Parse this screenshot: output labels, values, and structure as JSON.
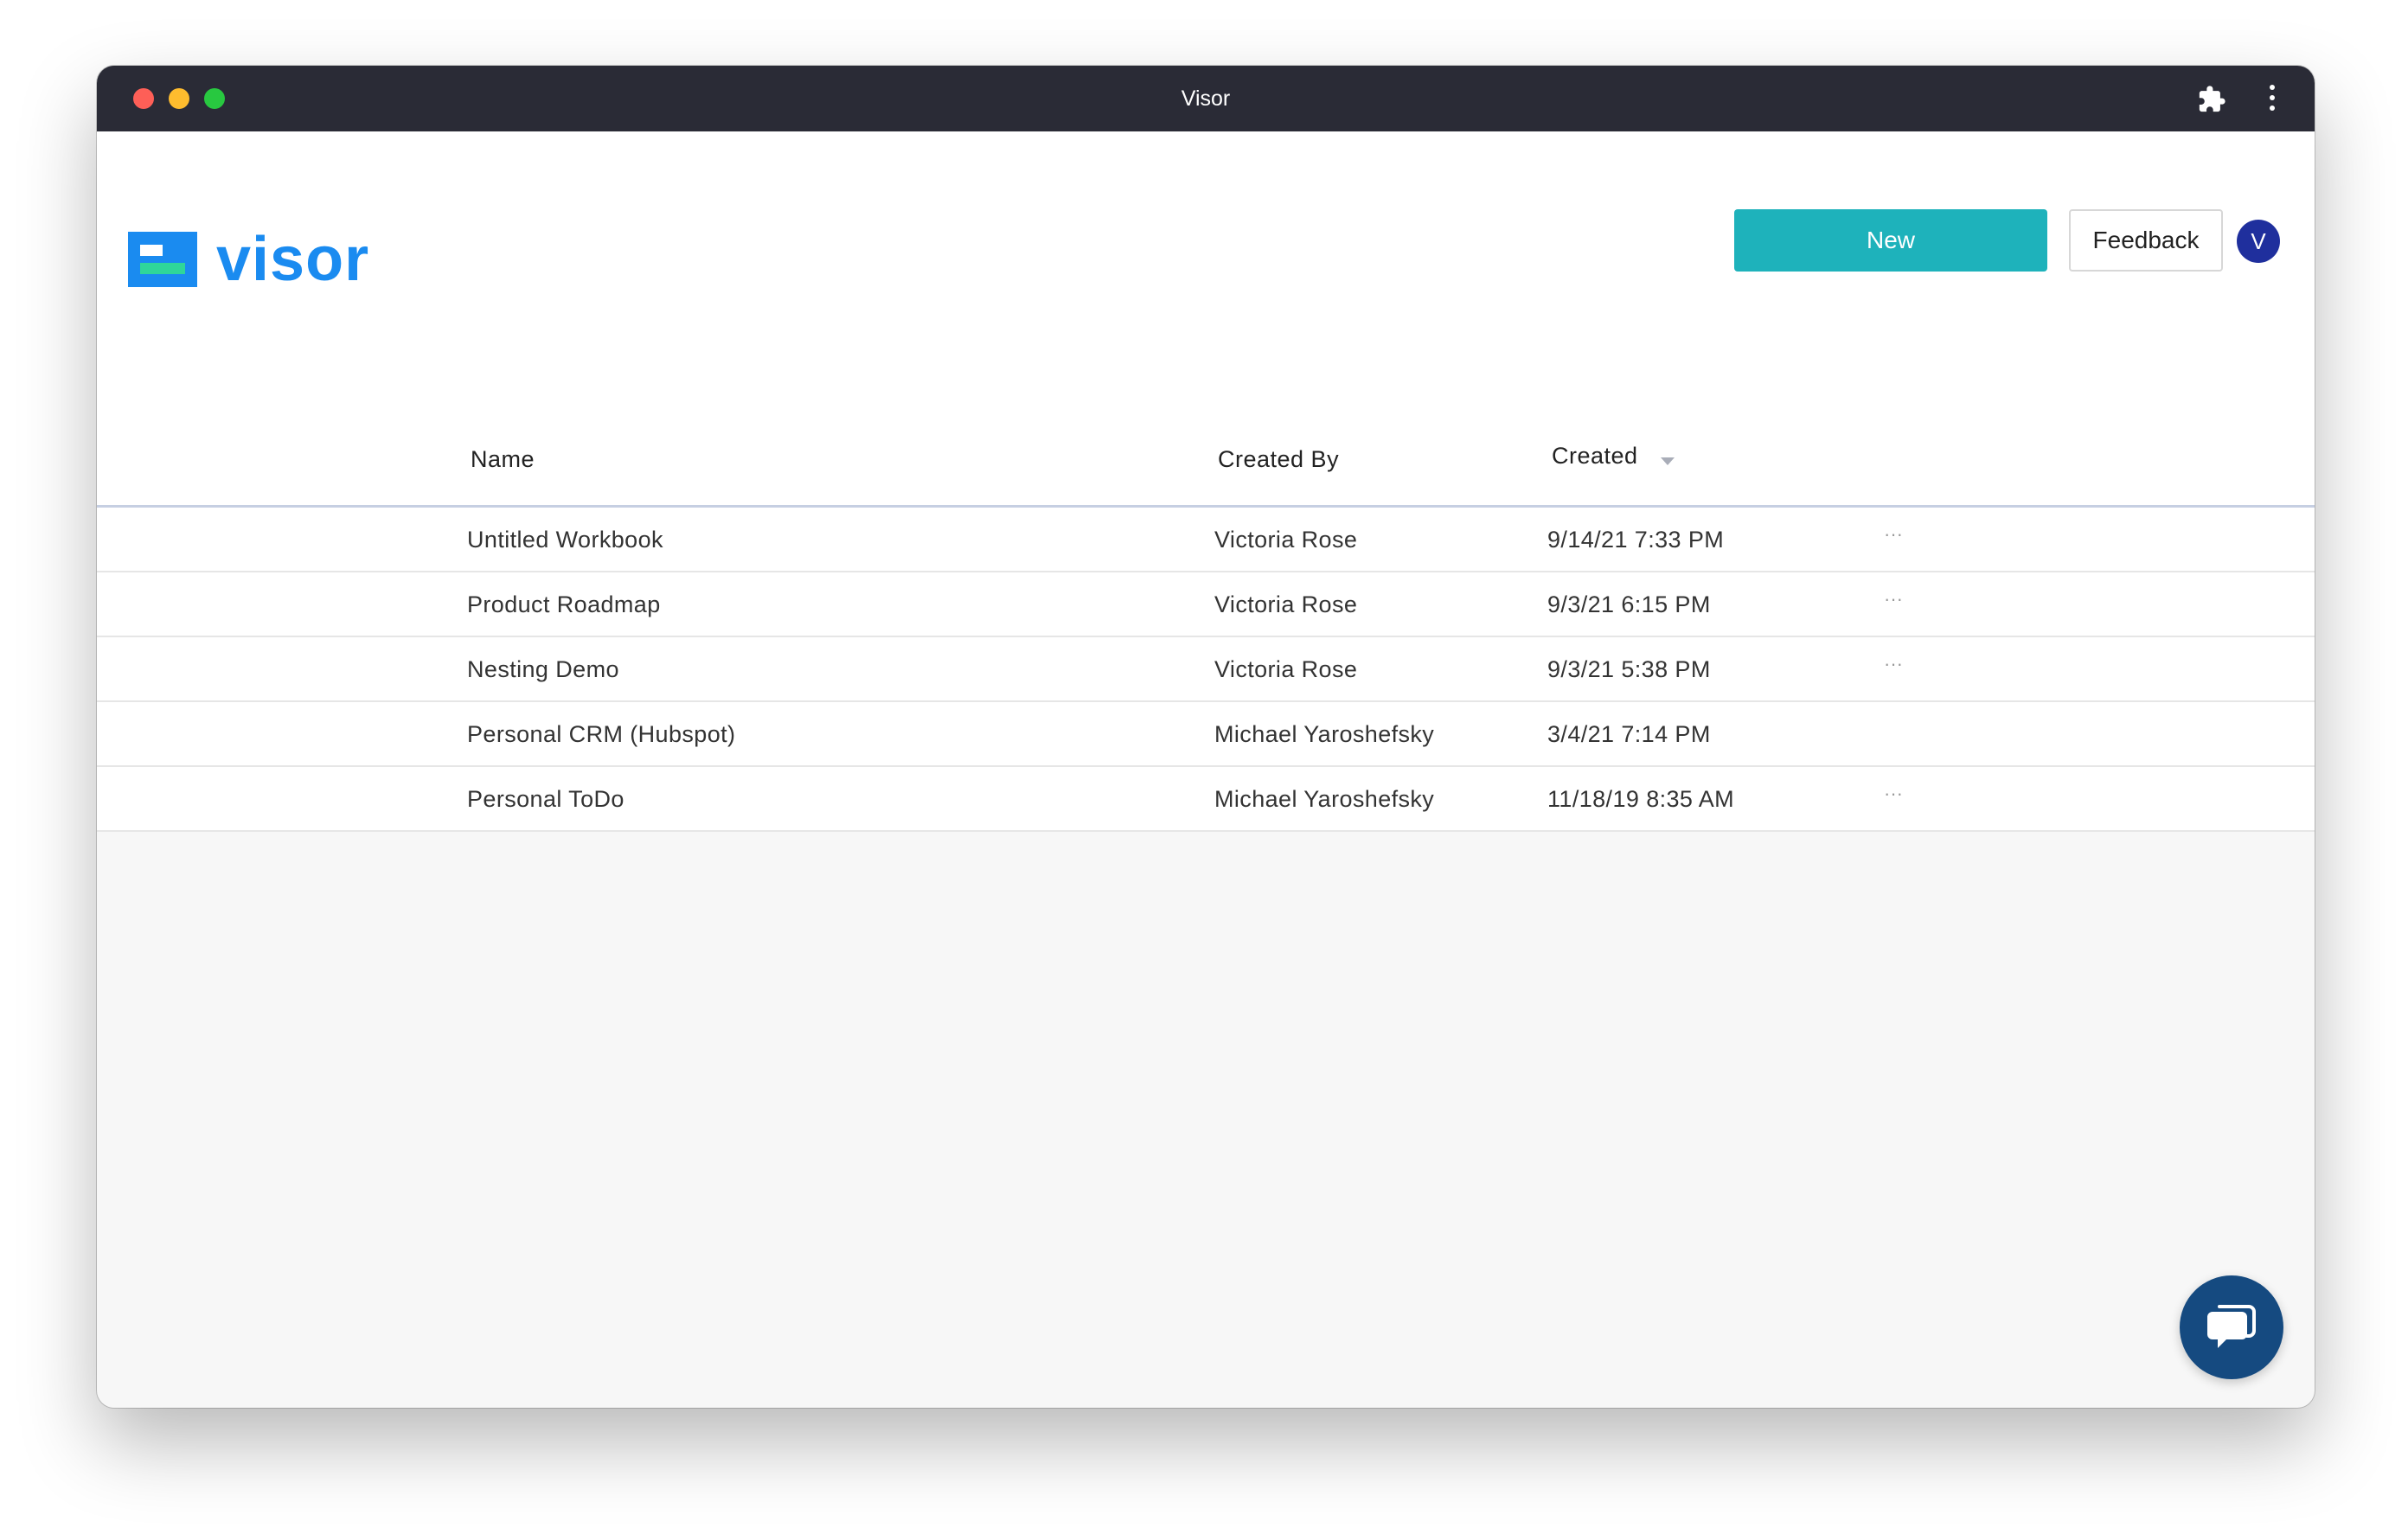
{
  "window": {
    "title": "Visor"
  },
  "brand": {
    "name": "visor",
    "color": "#1a8bf0",
    "mark_colors": [
      "#1a8bf0",
      "#2fd69a",
      "#ffffff"
    ]
  },
  "toolbar": {
    "new_label": "New",
    "feedback_label": "Feedback",
    "avatar_initial": "V",
    "new_color": "#1eb2bb"
  },
  "table": {
    "headers": {
      "name": "Name",
      "created_by": "Created By",
      "created": "Created"
    },
    "sort": {
      "column": "Created",
      "direction": "descending"
    },
    "rows": [
      {
        "name": "Untitled Workbook",
        "created_by": "Victoria Rose",
        "created": "9/14/21 7:33 PM",
        "more": "···"
      },
      {
        "name": "Product Roadmap",
        "created_by": "Victoria Rose",
        "created": "9/3/21 6:15 PM",
        "more": "···"
      },
      {
        "name": "Nesting Demo",
        "created_by": "Victoria Rose",
        "created": "9/3/21 5:38 PM",
        "more": "···"
      },
      {
        "name": "Personal CRM (Hubspot)",
        "created_by": "Michael Yaroshefsky",
        "created": "3/4/21 7:14 PM",
        "more": ""
      },
      {
        "name": "Personal ToDo",
        "created_by": "Michael Yaroshefsky",
        "created": "11/18/19 8:35 AM",
        "more": "···"
      }
    ]
  },
  "icons": {
    "extensions": "puzzle-icon",
    "menu": "kebab-icon",
    "chat": "chat-icon",
    "sort": "caret-down-icon"
  }
}
